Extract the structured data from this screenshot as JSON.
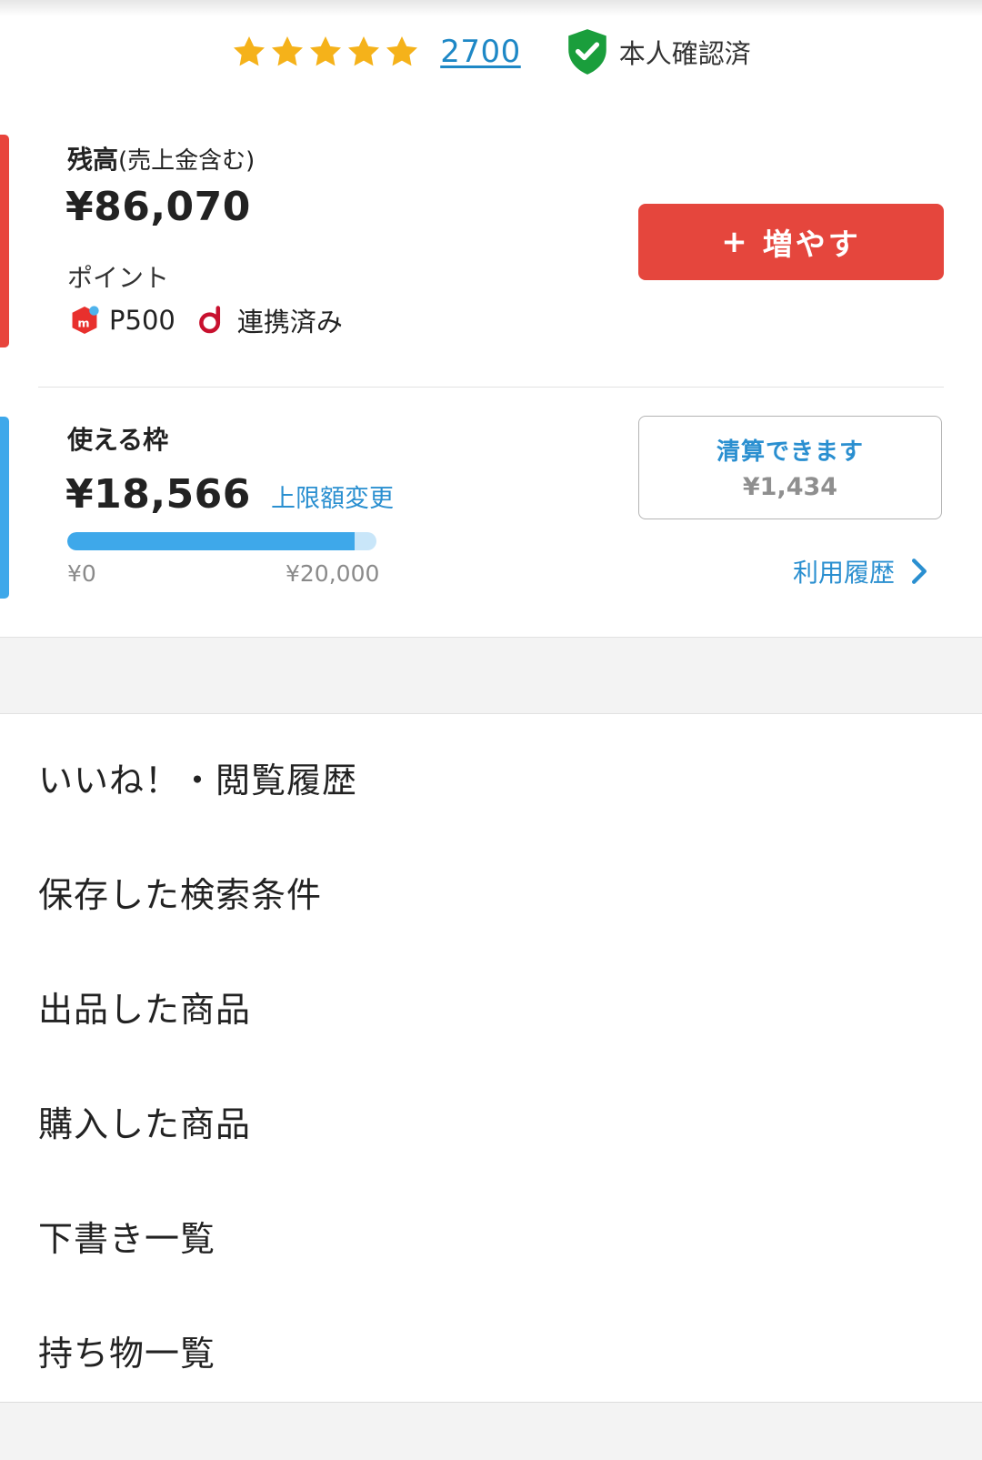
{
  "profile": {
    "rating_count": "2700",
    "verified_label": "本人確認済",
    "star_color": "#f5b21a",
    "verified_color": "#1a9e3c"
  },
  "balance": {
    "label": "残高",
    "label_note": "(売上金含む)",
    "amount": "¥86,070",
    "points_label": "ポイント",
    "merpoint_value": "P500",
    "dpoint_status": "連携済み",
    "increase_button": {
      "plus": "+",
      "label": "増やす"
    },
    "accent_color": "#e8443c"
  },
  "credit": {
    "label": "使える枠",
    "amount": "¥18,566",
    "limit_change_link": "上限額変更",
    "progress": {
      "min_label": "¥0",
      "max_label": "¥20,000",
      "fraction": 0.928
    },
    "settle_button": {
      "title": "清算できます",
      "amount": "¥1,434"
    },
    "history_link": "利用履歴",
    "accent_color": "#3ea8ea"
  },
  "menu": {
    "items": [
      {
        "label": "いいね！・閲覧履歴"
      },
      {
        "label": "保存した検索条件"
      },
      {
        "label": "出品した商品"
      },
      {
        "label": "購入した商品"
      },
      {
        "label": "下書き一覧"
      },
      {
        "label": "持ち物一覧"
      }
    ]
  }
}
